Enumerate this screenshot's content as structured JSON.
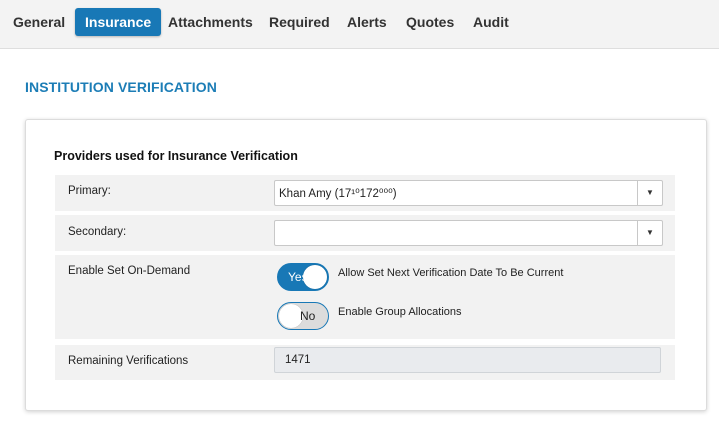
{
  "tabs": [
    {
      "label": "General",
      "active": false
    },
    {
      "label": "Insurance",
      "active": true
    },
    {
      "label": "Attachments",
      "active": false
    },
    {
      "label": "Required",
      "active": false
    },
    {
      "label": "Alerts",
      "active": false
    },
    {
      "label": "Quotes",
      "active": false
    },
    {
      "label": "Audit",
      "active": false
    }
  ],
  "section_title": "INSTITUTION VERIFICATION",
  "card": {
    "title": "Providers used for Insurance Verification",
    "primary": {
      "label": "Primary:",
      "value": "Khan Amy (17¹⁰172⁰⁰⁰)"
    },
    "secondary": {
      "label": "Secondary:",
      "value": ""
    },
    "on_demand": {
      "label": "Enable Set On-Demand",
      "toggle_yes": {
        "label": "Yes",
        "state": "on",
        "text": "Allow Set Next Verification Date To Be Current"
      },
      "toggle_no": {
        "label": "No",
        "state": "off",
        "text": "Enable Group Allocations"
      }
    },
    "remaining": {
      "label": "Remaining Verifications",
      "value": "1471"
    }
  },
  "icons": {
    "dropdown_arrow": "▼"
  },
  "colors": {
    "accent": "#1878b6",
    "title": "#1c7db6"
  }
}
